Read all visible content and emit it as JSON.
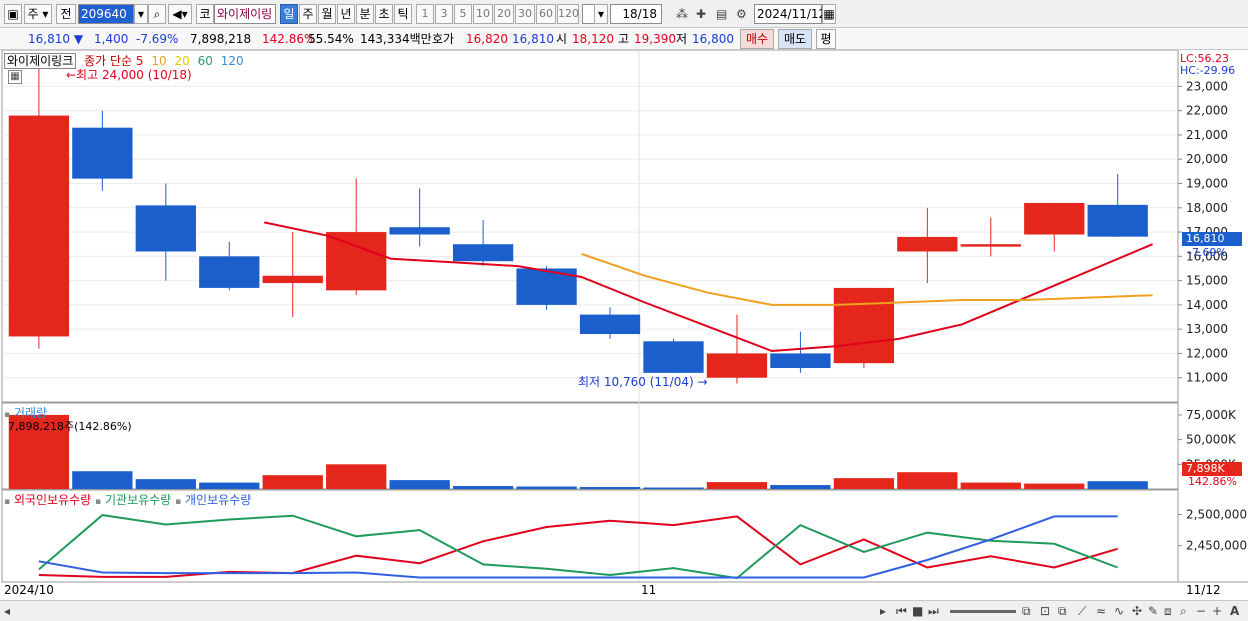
{
  "toolbar": {
    "market_label": "주",
    "prev_label": "전",
    "stock_code": "209640",
    "market_tag": "코",
    "stock_name": "와이제이링",
    "periods": [
      "일",
      "주",
      "월",
      "년",
      "분",
      "초",
      "틱"
    ],
    "selected_period": "일",
    "intervals": [
      "1",
      "3",
      "5",
      "10",
      "20",
      "30",
      "60",
      "120"
    ],
    "page_counter": "18/18",
    "date": "2024/11/12"
  },
  "info": {
    "price": "16,810",
    "change": "1,400",
    "change_pct": "-7.69%",
    "volume": "7,898,218",
    "volume_ratio": "142.86%",
    "turnover_pct": "55.54%",
    "amount": "143,334백만",
    "quote_label": "호가",
    "quote_value": "16,820",
    "quote_value2": "16,810",
    "open_label": "시",
    "open": "18,120",
    "high_label": "고",
    "high": "19,390",
    "low_label": "저",
    "low": "16,800",
    "buy_label": "매수",
    "sell_label": "매도",
    "flat_label": "평"
  },
  "chart_data": [
    {
      "type": "candlestick",
      "title": "와이제이링크",
      "legend": {
        "label": "종가 단순",
        "mas": [
          "5",
          "10",
          "20",
          "60",
          "120"
        ]
      },
      "ylim": [
        10000,
        24500
      ],
      "yticks": [
        "23,000",
        "22,000",
        "21,000",
        "20,000",
        "19,000",
        "18,000",
        "17,000",
        "16,000",
        "15,000",
        "14,000",
        "13,000",
        "12,000",
        "11,000"
      ],
      "candles": [
        {
          "o": 12700,
          "h": 24000,
          "l": 12200,
          "c": 21800
        },
        {
          "o": 21300,
          "h": 22000,
          "l": 18700,
          "c": 19200
        },
        {
          "o": 18100,
          "h": 19000,
          "l": 15000,
          "c": 16200
        },
        {
          "o": 16000,
          "h": 16600,
          "l": 14600,
          "c": 14700
        },
        {
          "o": 14900,
          "h": 17000,
          "l": 13500,
          "c": 15200
        },
        {
          "o": 14600,
          "h": 19200,
          "l": 14400,
          "c": 17000
        },
        {
          "o": 17200,
          "h": 18800,
          "l": 16400,
          "c": 16900
        },
        {
          "o": 16500,
          "h": 17500,
          "l": 15600,
          "c": 15800
        },
        {
          "o": 15500,
          "h": 15600,
          "l": 13800,
          "c": 14000
        },
        {
          "o": 13600,
          "h": 13900,
          "l": 12600,
          "c": 12800
        },
        {
          "o": 12500,
          "h": 12600,
          "l": 11200,
          "c": 11200
        },
        {
          "o": 11000,
          "h": 13600,
          "l": 10760,
          "c": 12000
        },
        {
          "o": 12000,
          "h": 12900,
          "l": 11200,
          "c": 11400
        },
        {
          "o": 11600,
          "h": 14700,
          "l": 11400,
          "c": 14700
        },
        {
          "o": 16200,
          "h": 18000,
          "l": 14900,
          "c": 16800
        },
        {
          "o": 16400,
          "h": 17600,
          "l": 16000,
          "c": 16500
        },
        {
          "o": 16900,
          "h": 18200,
          "l": 16200,
          "c": 18200
        },
        {
          "o": 18120,
          "h": 19390,
          "l": 16800,
          "c": 16810
        }
      ],
      "ma5": [
        null,
        null,
        null,
        null,
        17400,
        16850,
        15900,
        15750,
        15600,
        15150,
        14100,
        13100,
        12100,
        12300,
        12600,
        13200,
        14300,
        15400,
        16500
      ],
      "ma10": [
        null,
        null,
        null,
        null,
        null,
        null,
        null,
        null,
        null,
        16100,
        15200,
        14500,
        14000,
        14000,
        14100,
        14200,
        14200,
        14300,
        14400
      ],
      "colors": {
        "up": "#e5261d",
        "down": "#1a5fcc",
        "ma5": "#e0001b",
        "ma10": "#f0a020",
        "ma20": "#e8c800",
        "ma60": "#2aa06a",
        "ma120": "#3a8bd8"
      },
      "annotations": [
        {
          "text": "←최고 24,000 (10/18)",
          "color": "#e0001b"
        },
        {
          "text": "최저 10,760 (11/04)",
          "color": "#1a3ccf"
        }
      ],
      "lc_label": "LC:56.23",
      "hc_label": "HC:-29.96",
      "last_price": "16,810",
      "last_pct": "-7.69%"
    },
    {
      "type": "bar",
      "title": "거래량",
      "summary": "7,898,218주(142.86%)",
      "yticks": [
        "75,000K",
        "50,000K",
        "25,000K"
      ],
      "last_label": "7,898K",
      "last_pct": "142.86%",
      "values": [
        75000,
        18000,
        10000,
        6500,
        14000,
        25000,
        9000,
        3000,
        2500,
        2000,
        1500,
        7000,
        4000,
        11000,
        17000,
        6500,
        5500,
        7898
      ]
    },
    {
      "type": "line",
      "series": [
        {
          "name": "외국인보유수량",
          "color": "#e0001b",
          "values": [
            2403000,
            2400000,
            2400000,
            2408000,
            2406000,
            2434000,
            2422000,
            2457000,
            2480000,
            2490000,
            2483000,
            2497000,
            2420000,
            2460000,
            2415000,
            2433000,
            2415000,
            2445000
          ]
        },
        {
          "name": "기관보유수량",
          "color": "#1f9a5a",
          "values": [
            2412000,
            2499000,
            2484000,
            2492000,
            2498000,
            2465000,
            2475000,
            2420000,
            2413000,
            2403000,
            2414000,
            2398000,
            2483000,
            2440000,
            2471000,
            2458000,
            2453000,
            2415000
          ]
        },
        {
          "name": "개인보유수량",
          "color": "#3060e0",
          "values": [
            2425000,
            2407000,
            2406000,
            2406000,
            2406000,
            2407000,
            2399000,
            2399000,
            2399000,
            2399000,
            2399000,
            2399000,
            2399000,
            2399000,
            2427000,
            2460000,
            2497000,
            2497000
          ]
        }
      ],
      "ylim": [
        2395000,
        2520000
      ],
      "yticks": [
        "2,500,000",
        "2,450,000"
      ]
    }
  ],
  "xaxis": {
    "start": "2024/10",
    "mid": "11",
    "end": "11/12"
  }
}
